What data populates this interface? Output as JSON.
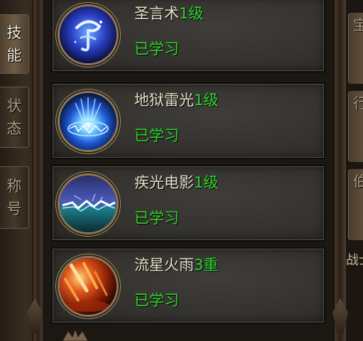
{
  "side_tabs": [
    {
      "label": "技能",
      "chars": [
        "技",
        "能"
      ],
      "active": true
    },
    {
      "label": "状态",
      "chars": [
        "状",
        "态"
      ],
      "active": false
    },
    {
      "label": "称号",
      "chars": [
        "称",
        "号"
      ],
      "active": false
    }
  ],
  "right_side": {
    "tab_fragments": [
      "宝",
      "行",
      "伯"
    ],
    "text_fragment": "战士"
  },
  "skills": [
    {
      "name": "圣言术",
      "level": "1级",
      "status": "已学习",
      "icon": "holy-word-icon"
    },
    {
      "name": "地狱雷光",
      "level": "1级",
      "status": "已学习",
      "icon": "hell-lightning-icon"
    },
    {
      "name": "疾光电影",
      "level": "1级",
      "status": "已学习",
      "icon": "swift-lightning-icon"
    },
    {
      "name": "流星火雨",
      "level": "3重",
      "status": "已学习",
      "icon": "meteor-rain-icon"
    }
  ],
  "colors": {
    "learned_green": "#2dd52d",
    "skill_name": "#e8dec9",
    "frame_gold": "#8c7756"
  }
}
